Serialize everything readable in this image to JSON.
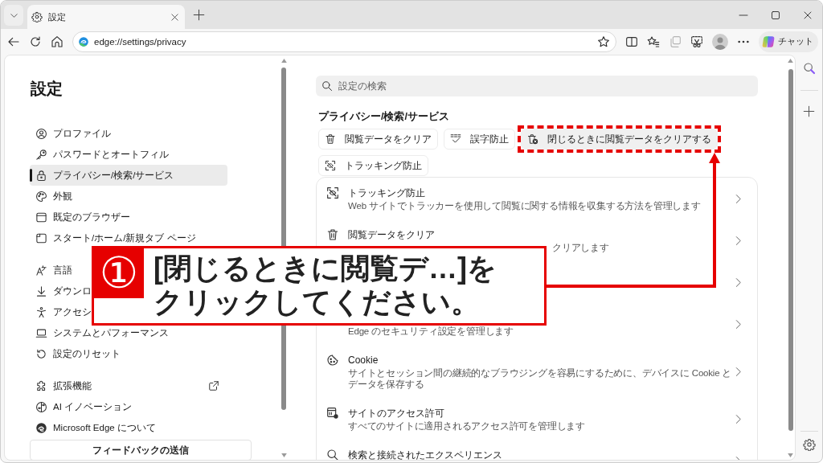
{
  "browser": {
    "tabs": [
      {
        "title": "設定",
        "selected": true
      }
    ],
    "address": "edge://settings/privacy",
    "chat_button": "チャット"
  },
  "sidebar": {
    "title": "設定",
    "groups": [
      {
        "items": [
          {
            "kind": "profile",
            "label": "プロファイル",
            "selected": false,
            "external": false
          },
          {
            "kind": "password",
            "label": "パスワードとオートフィル",
            "selected": false,
            "external": false
          },
          {
            "kind": "privacy",
            "label": "プライバシー/検索/サービス",
            "selected": true,
            "external": false
          },
          {
            "kind": "appearance",
            "label": "外観",
            "selected": false,
            "external": false
          },
          {
            "kind": "default_browser",
            "label": "既定のブラウザー",
            "selected": false,
            "external": false
          },
          {
            "kind": "start_page",
            "label": "スタート/ホーム/新規タブ ページ",
            "selected": false,
            "external": false
          }
        ]
      },
      {
        "items": [
          {
            "kind": "languages",
            "label": "言語",
            "selected": false,
            "external": false
          },
          {
            "kind": "downloads",
            "label": "ダウンロ",
            "selected": false,
            "external": false
          },
          {
            "kind": "accessibility",
            "label": "アクセシ",
            "selected": false,
            "external": false
          },
          {
            "kind": "system",
            "label": "システムとパフォーマンス",
            "selected": false,
            "external": false
          },
          {
            "kind": "reset",
            "label": "設定のリセット",
            "selected": false,
            "external": false
          }
        ]
      },
      {
        "items": [
          {
            "kind": "extensions",
            "label": "拡張機能",
            "selected": false,
            "external": true
          },
          {
            "kind": "ai",
            "label": "AI イノベーション",
            "selected": false,
            "external": false
          },
          {
            "kind": "about",
            "label": "Microsoft Edge について",
            "selected": false,
            "external": false
          }
        ]
      }
    ],
    "feedback_button": "フィードバックの送信"
  },
  "main": {
    "search": {
      "placeholder": "設定の検索"
    },
    "section_title": "プライバシー/検索/サービス",
    "quick_links": [
      {
        "kind": "trash",
        "label": "閲覧データをクリア",
        "highlighted": false
      },
      {
        "kind": "spellcheck",
        "label": "誤字防止",
        "highlighted": false
      },
      {
        "kind": "clear_on_close",
        "label": "閉じるときに閲覧データをクリアする",
        "highlighted": true
      },
      {
        "kind": "tracking",
        "label": "トラッキング防止",
        "highlighted": false
      }
    ],
    "rows": [
      {
        "kind": "tracking",
        "title": "トラッキング防止",
        "subtitle": "Web サイトでトラッカーを使用して閲覧に関する情報を収集する方法を管理します"
      },
      {
        "kind": "trash",
        "title": "閲覧データをクリア",
        "subtitle_tail": "クリアします"
      },
      {
        "kind": "covered"
      },
      {
        "kind": "covered",
        "subtitle": "Edge のセキュリティ設定を管理します"
      },
      {
        "kind": "cookie",
        "title": "Cookie",
        "subtitle": "サイトとセッション間の継続的なブラウジングを容易にするために、デバイスに Cookie とデータを保存する"
      },
      {
        "kind": "permissions",
        "title": "サイトのアクセス許可",
        "subtitle": "すべてのサイトに適用されるアクセス許可を管理します"
      },
      {
        "kind": "search",
        "title": "検索と接続されたエクスペリエンス"
      }
    ]
  },
  "callout": {
    "step": "①",
    "lines": [
      "[閉じるときに閲覧デ…]を",
      "クリックしてください。"
    ]
  }
}
